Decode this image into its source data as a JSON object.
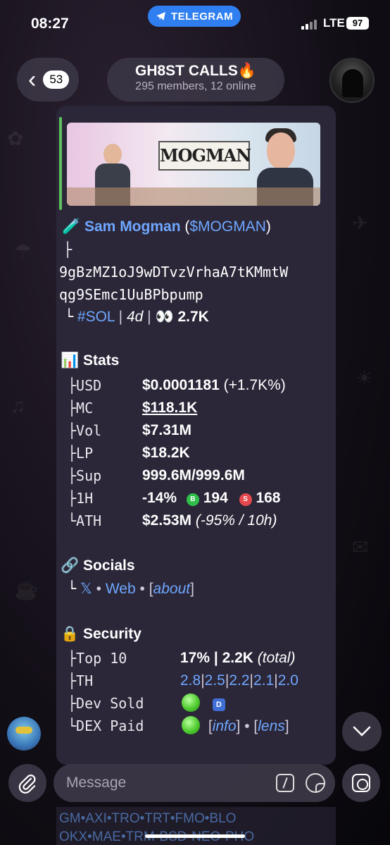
{
  "status_bar": {
    "time": "08:27",
    "app_pill": "TELEGRAM",
    "network": "LTE",
    "battery": "97"
  },
  "header": {
    "back_count": "53",
    "title": "GH8ST CALLS🔥",
    "subtitle": "295 members, 12 online"
  },
  "message": {
    "image_caption": "MOGMAN",
    "token_icon": "🧪",
    "token_name": "Sam Mogman",
    "token_ticker": "$MOGMAN",
    "address_prefix": "├",
    "address_line1": "9gBzMZ1oJ9wDTvzVrhaA7tKMmtW",
    "address_line2": "qg9SEmc1UuBPbpump",
    "chain_prefix": "└",
    "chain": "#SOL",
    "age": "4d",
    "views_icon": "👀",
    "views": "2.7K",
    "stats_icon": "📊",
    "stats_title": "Stats",
    "stats": [
      {
        "key": "├USD",
        "value": "$0.0001181",
        "extra": " (+1.7K%)"
      },
      {
        "key": "├MC",
        "value": "$118.1K",
        "extra": ""
      },
      {
        "key": "├Vol",
        "value": "$7.31M",
        "extra": ""
      },
      {
        "key": "├LP",
        "value": "$18.2K",
        "extra": ""
      },
      {
        "key": "├Sup",
        "value": "999.6M/999.6M",
        "extra": ""
      }
    ],
    "hour": {
      "key": "├1H",
      "change": "-14%",
      "buys": "194",
      "sells": "168",
      "buy_badge": "B",
      "sell_badge": "S"
    },
    "ath": {
      "key": "└ATH",
      "value": "$2.53M",
      "extra": " (-95% / 10h)"
    },
    "socials_icon": "🔗",
    "socials_title": "Socials",
    "socials_prefix": "└",
    "socials_x": "𝕏",
    "socials_web": "Web",
    "socials_about": "about",
    "security_icon": "🔒",
    "security_title": "Security",
    "top10": {
      "key": "├Top 10",
      "value": "17% | 2.2K",
      "extra": "(total)"
    },
    "th": {
      "key": "├TH",
      "values": [
        "2.8",
        "2.5",
        "2.2",
        "2.1",
        "2.0"
      ]
    },
    "dev_sold": {
      "key": "├Dev Sold",
      "badge": "D"
    },
    "dex_paid": {
      "key": "└DEX Paid",
      "info": "info",
      "lens": "lens"
    }
  },
  "composer": {
    "placeholder": "Message"
  },
  "bottom_strip": "GM•AXI•TRO•TRT•FMO•BLO OKX•MAE•TRM•BSD•NEO•PHO",
  "colors": {
    "accent": "#6fa7ff",
    "bubble": "#2b2738",
    "telegram": "#2f7ff0",
    "green": "#4ecb2e",
    "buy": "#2fbf4a",
    "sell": "#e5484d"
  }
}
